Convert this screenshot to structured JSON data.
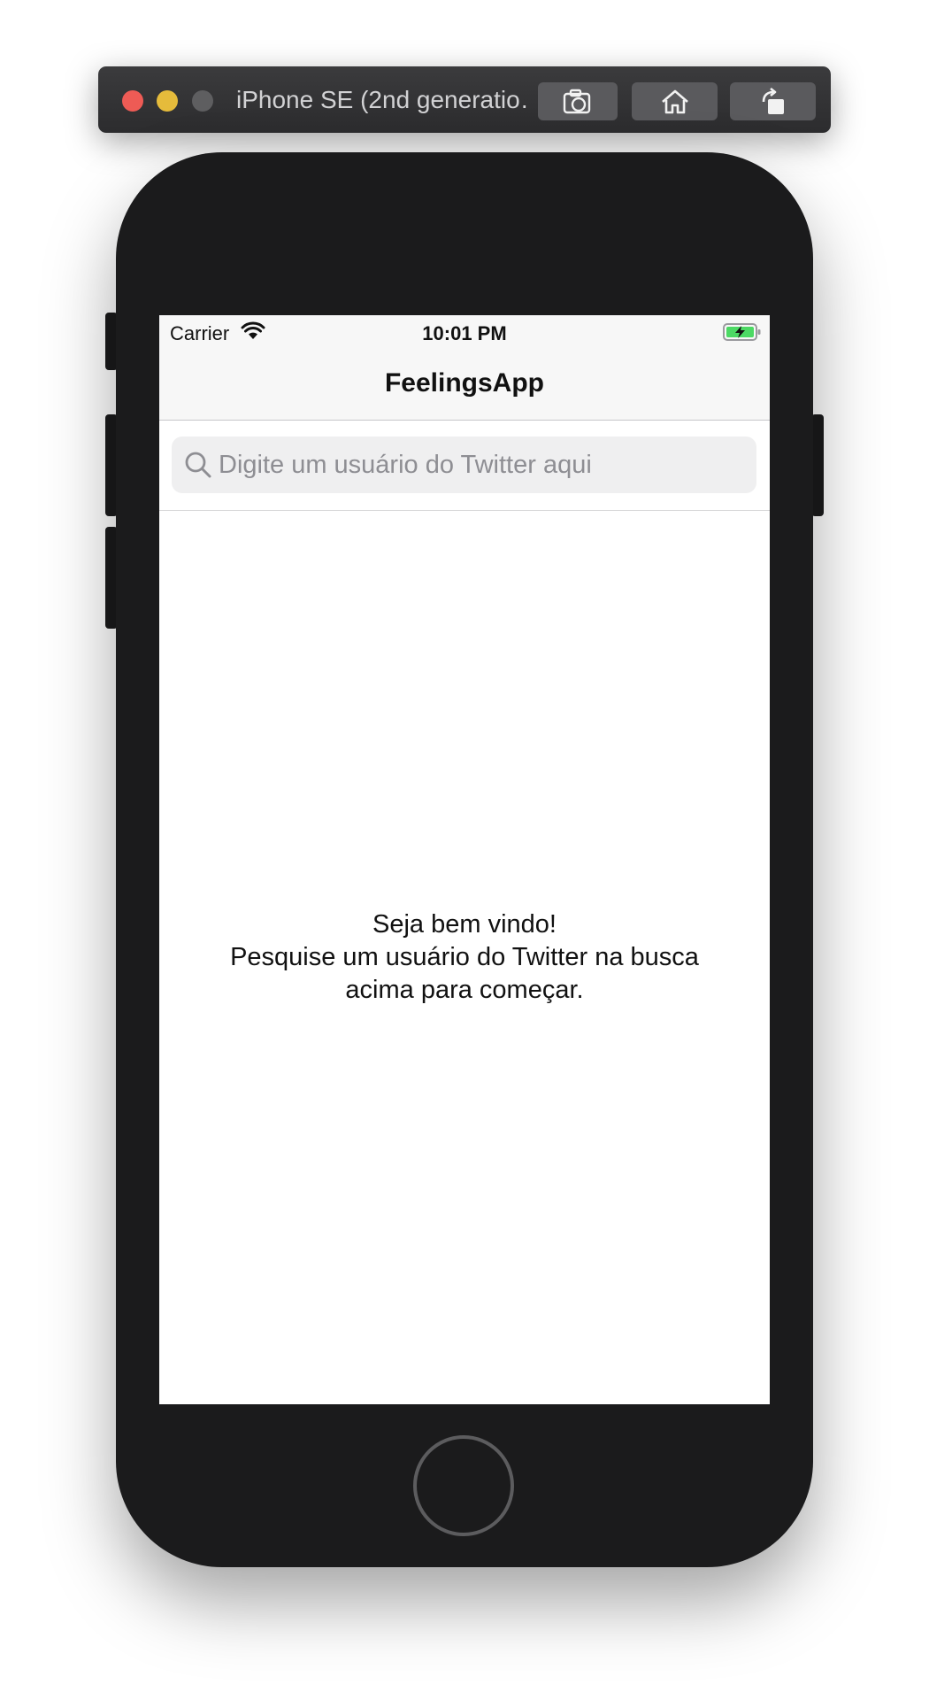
{
  "simulator": {
    "title": "iPhone SE (2nd generatio…",
    "toolbar": {
      "screenshot_icon": "camera-icon",
      "home_icon": "home-icon",
      "rotate_icon": "rotate-icon"
    }
  },
  "status_bar": {
    "carrier": "Carrier",
    "time": "10:01 PM",
    "battery_state": "charging",
    "battery_color": "#4cd964"
  },
  "nav": {
    "title": "FeelingsApp"
  },
  "search": {
    "placeholder": "Digite um usuário do Twitter aqui",
    "value": ""
  },
  "welcome": {
    "line1": "Seja bem vindo!",
    "line2": "Pesquise um usuário do Twitter na busca",
    "line3": "acima para começar."
  }
}
